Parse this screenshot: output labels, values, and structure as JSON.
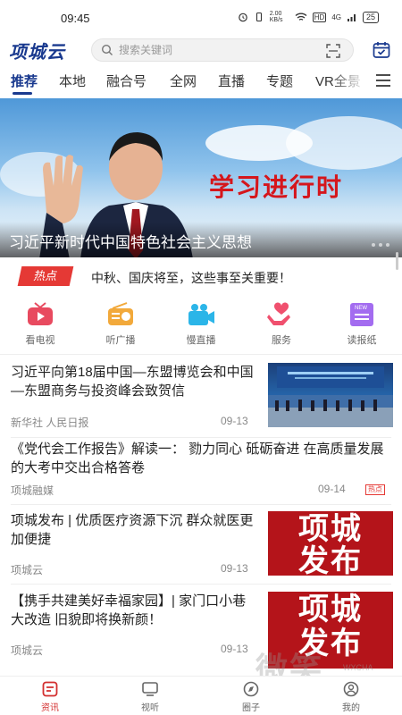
{
  "status_bar": {
    "time": "09:45",
    "network": "2.00 KB/s",
    "hd": "HD",
    "signal": "4G",
    "battery": "25"
  },
  "header": {
    "logo_text": "项城云",
    "search_placeholder": "搜索关键词"
  },
  "tabs": [
    {
      "label": "推荐",
      "active": true
    },
    {
      "label": "本地"
    },
    {
      "label": "融合号"
    },
    {
      "label": "全网"
    },
    {
      "label": "直播"
    },
    {
      "label": "专题"
    },
    {
      "label": "VR全景"
    }
  ],
  "banner": {
    "slogan": "学习进行时",
    "caption": "习近平新时代中国特色社会主义思想"
  },
  "hot": {
    "badge": "热点",
    "text": "中秋、国庆将至，这些事至关重要！"
  },
  "quick_links": [
    {
      "label": "看电视",
      "icon": "tv-icon",
      "color": "#e84a5f"
    },
    {
      "label": "听广播",
      "icon": "radio-icon",
      "color": "#f2a93b"
    },
    {
      "label": "慢直播",
      "icon": "video-camera-icon",
      "color": "#2bb5e8"
    },
    {
      "label": "服务",
      "icon": "hands-heart-icon",
      "color": "#f0506e"
    },
    {
      "label": "读报纸",
      "icon": "newspaper-icon",
      "color": "#a36cf0"
    }
  ],
  "news": [
    {
      "title": "习近平向第18届中国—东盟博览会和中国—东盟商务与投资峰会致贺信",
      "source": "新华社 人民日报",
      "time": "09-13",
      "thumb": "conference"
    },
    {
      "title": "《党代会工作报告》解读一： 勠力同心 砥砺奋进 在高质量发展的大考中交出合格答卷",
      "source": "项城融媒",
      "time": "09-14",
      "tag": "热点"
    },
    {
      "title": "项城发布 | 优质医疗资源下沉 群众就医更加便捷",
      "source": "项城云",
      "time": "09-13",
      "thumb_text": [
        "项城",
        "发布"
      ]
    },
    {
      "title": "【携手共建美好幸福家园】| 家门口小巷大改造 旧貌即将换新颜！",
      "source": "项城云",
      "time": "09-13",
      "thumb_text": [
        "项城",
        "发布"
      ]
    }
  ],
  "bottom_nav": [
    {
      "label": "资讯",
      "icon": "news-icon",
      "active": true
    },
    {
      "label": "视听",
      "icon": "tv-icon"
    },
    {
      "label": "圈子",
      "icon": "compass-icon"
    },
    {
      "label": "我的",
      "icon": "user-icon"
    }
  ],
  "watermark": {
    "text": "微笑",
    "sub": "WXCHA"
  },
  "colors": {
    "brand": "#1a3a8f",
    "hot": "#e53935",
    "active_nav": "#d32f2f",
    "banner_slogan": "#d5161c"
  }
}
